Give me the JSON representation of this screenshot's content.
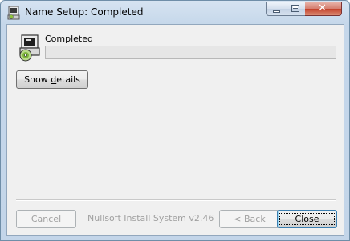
{
  "window": {
    "title": "Name Setup: Completed",
    "icons": {
      "app": "installer-icon",
      "minimize": "minimize-icon",
      "maximize": "maximize-icon",
      "close": "close-icon"
    },
    "colors": {
      "close_button": "#c4412a",
      "frame": "#c5d7ea",
      "client": "#f0f0f0"
    }
  },
  "content": {
    "status_text": "Completed",
    "progress_fraction": 0,
    "icon": "installer-cd-icon"
  },
  "buttons": {
    "show_details": {
      "label_pre": "Show ",
      "label_accel": "d",
      "label_post": "etails"
    },
    "cancel": {
      "label": "Cancel",
      "enabled": false
    },
    "back": {
      "label_pre": "< ",
      "label_accel": "B",
      "label_post": "ack",
      "enabled": false
    },
    "close": {
      "label_accel": "C",
      "label_post": "lose",
      "enabled": true,
      "default": true
    }
  },
  "branding": "Nullsoft Install System v2.46"
}
